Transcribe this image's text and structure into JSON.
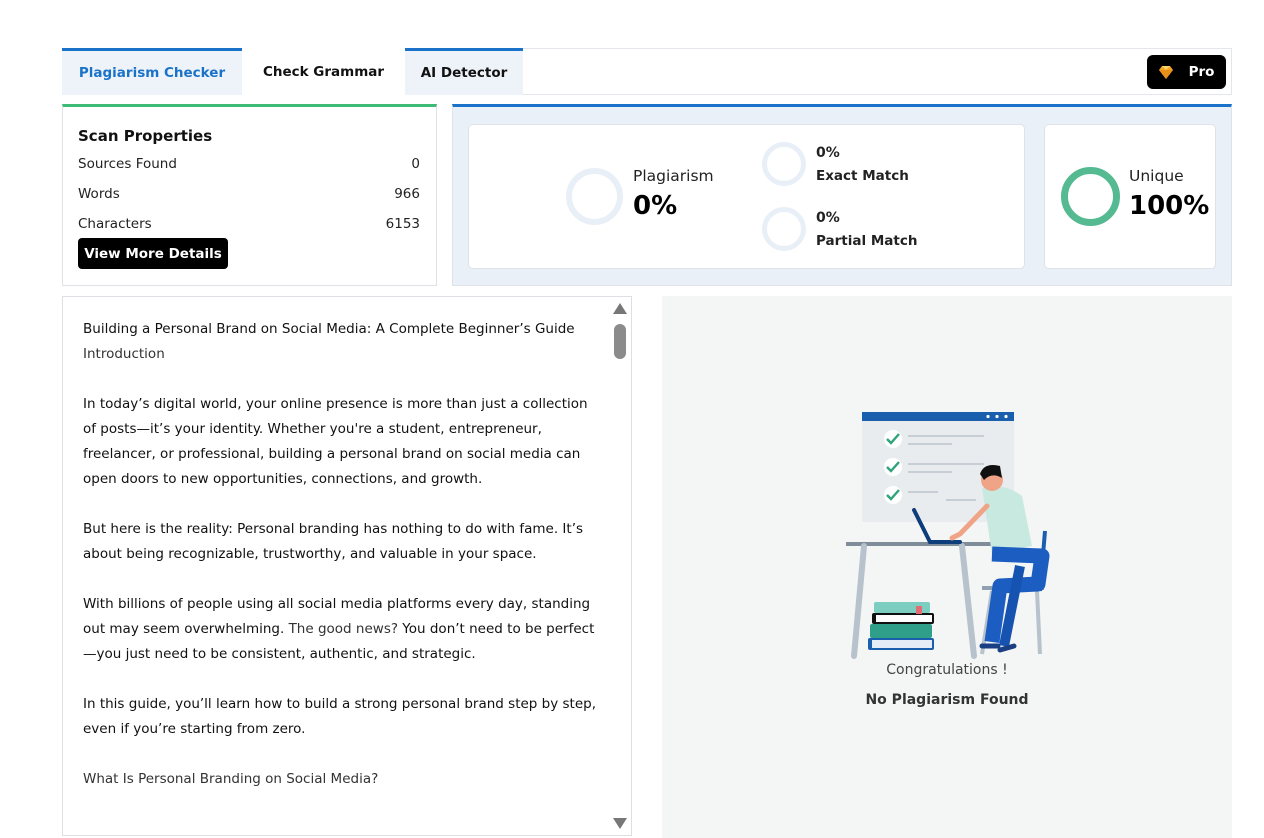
{
  "tabs": [
    {
      "label": "Plagiarism Checker",
      "active": true
    },
    {
      "label": "Check Grammar",
      "active": false
    },
    {
      "label": "AI Detector",
      "active": false
    }
  ],
  "pro_button": {
    "label": "Pro",
    "icon": "diamond-icon"
  },
  "scan_properties": {
    "title": "Scan Properties",
    "rows": [
      {
        "label": "Sources Found",
        "value": "0"
      },
      {
        "label": "Words",
        "value": "966"
      },
      {
        "label": "Characters",
        "value": "6153"
      }
    ],
    "button_label": "View More Details"
  },
  "stats": {
    "plagiarism_label": "Plagiarism",
    "plagiarism_value": "0%",
    "exact_value": "0%",
    "exact_label": "Exact Match",
    "partial_value": "0%",
    "partial_label": "Partial Match",
    "unique_label": "Unique",
    "unique_value": "100%"
  },
  "editor": {
    "title": "Building a Personal Brand on Social Media: A Complete Beginner’s Guide",
    "intro_heading": "Introduction",
    "paragraph1": "In today’s digital world, your online presence is more than just a collection of posts—it’s your identity. Whether you're a student, entrepreneur, freelancer, or professional, building a personal brand on social media can open doors to new opportunities, connections, and growth.",
    "paragraph2": "But here is the reality: Personal branding has nothing to do with fame. It’s about being recognizable, trustworthy, and valuable in your space.",
    "paragraph3a": "With billions of people using all social media platforms every day, standing out may seem overwhelming. ",
    "paragraph3b": "The good news?",
    "paragraph3c": " You don’t need to be perfect—you just need to be consistent, authentic, and strategic.",
    "paragraph4": "In this guide, you’ll learn how to build a strong personal brand step by step, even if you’re starting from zero.",
    "heading2": "What Is Personal Branding on Social Media?"
  },
  "result": {
    "congrats": "Congratulations !",
    "message": "No Plagiarism Found"
  },
  "colors": {
    "accent_blue": "#1a73c9",
    "accent_green": "#3dbb74",
    "unique_ring": "#55b992"
  }
}
